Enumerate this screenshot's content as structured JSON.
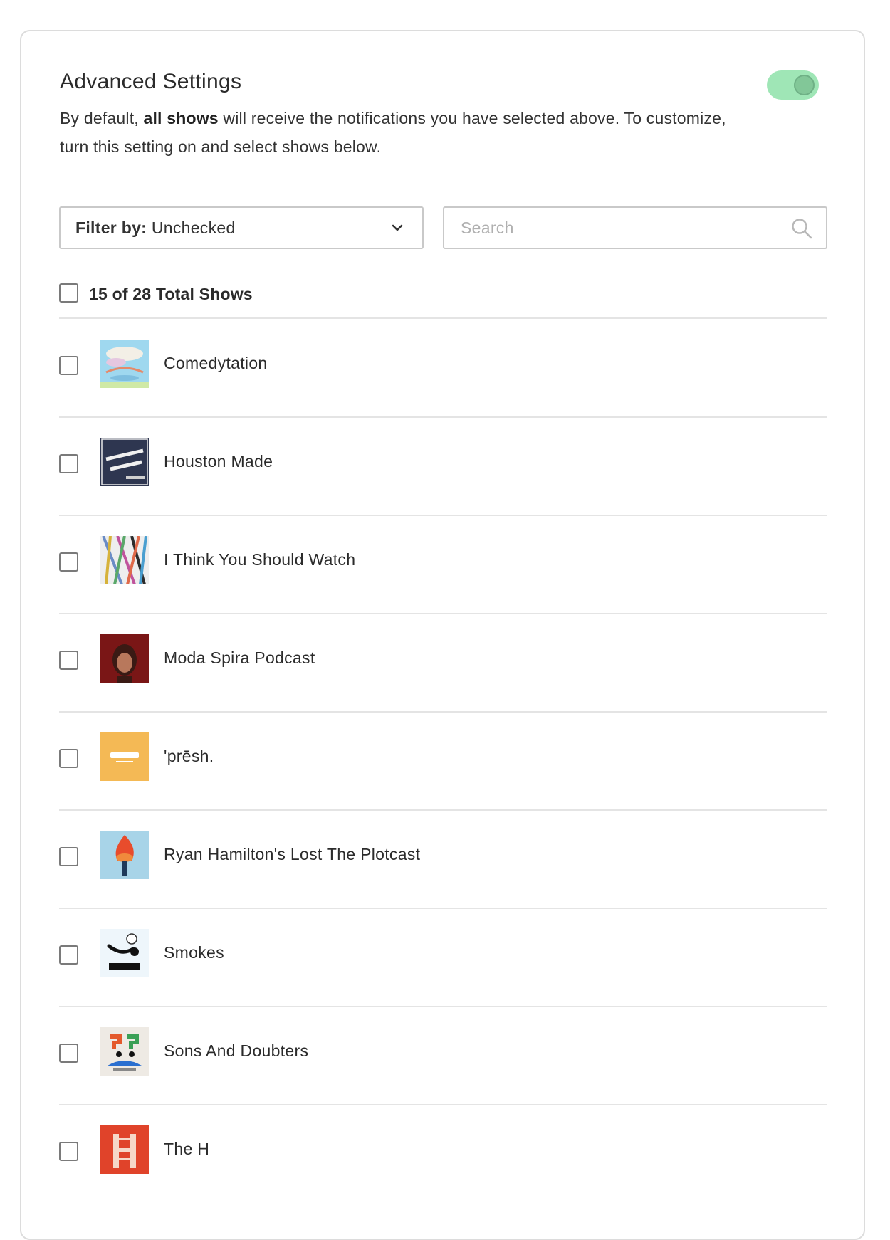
{
  "settings": {
    "title": "Advanced Settings",
    "desc_prefix": "By default, ",
    "desc_bold": "all shows",
    "desc_suffix": " will receive the notifications you have selected above. To customize, turn this setting on and select shows below.",
    "toggle_on": true
  },
  "filter": {
    "label": "Filter by:",
    "value": "Unchecked"
  },
  "search": {
    "placeholder": "Search",
    "value": ""
  },
  "list": {
    "total_label": "15 of 28 Total Shows",
    "shows": [
      {
        "name": "Comedytation",
        "checked": false
      },
      {
        "name": "Houston Made",
        "checked": false
      },
      {
        "name": "I Think You Should Watch",
        "checked": false
      },
      {
        "name": "Moda Spira Podcast",
        "checked": false
      },
      {
        "name": "'prēsh.",
        "checked": false
      },
      {
        "name": "Ryan Hamilton's Lost The Plotcast",
        "checked": false
      },
      {
        "name": "Smokes",
        "checked": false
      },
      {
        "name": "Sons And Doubters",
        "checked": false
      },
      {
        "name": "The H",
        "checked": false
      }
    ]
  },
  "colors": {
    "toggle_track": "#9fe6b6",
    "toggle_knob": "#82c798",
    "border": "#c9c9c9",
    "divider": "#e4e4e4"
  }
}
